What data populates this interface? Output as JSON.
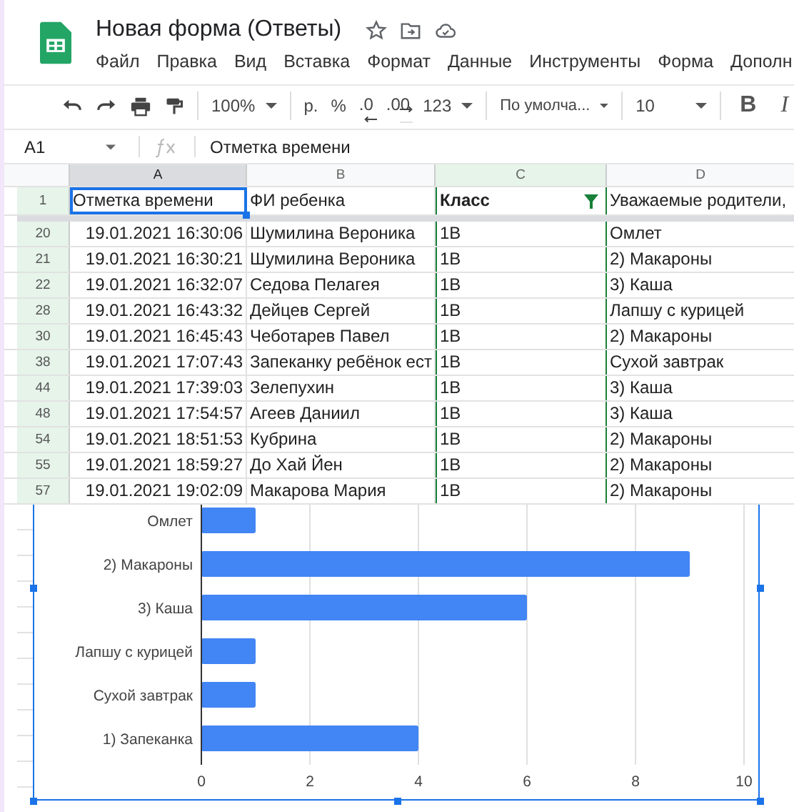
{
  "document": {
    "title": "Новая форма (Ответы)"
  },
  "menu": [
    "Файл",
    "Правка",
    "Вид",
    "Вставка",
    "Формат",
    "Данные",
    "Инструменты",
    "Форма",
    "Дополн"
  ],
  "toolbar": {
    "zoom": "100%",
    "currency": "р.",
    "percent": "%",
    "decimal_decrease": ".0",
    "decimal_increase": ".00",
    "number_format": "123",
    "font": "По умолча...",
    "font_size": "10",
    "bold": "B",
    "italic": "I"
  },
  "formula_bar": {
    "cell": "A1",
    "content": "Отметка времени"
  },
  "columns": [
    {
      "label": "A",
      "selected": true,
      "filtered": false
    },
    {
      "label": "B",
      "selected": false,
      "filtered": false
    },
    {
      "label": "C",
      "selected": false,
      "filtered": true
    },
    {
      "label": "D",
      "selected": false,
      "filtered": false
    }
  ],
  "header_row": {
    "number": "1",
    "cells": [
      {
        "text": "Отметка времени",
        "active": true
      },
      {
        "text": "ФИ ребенка",
        "active": false
      },
      {
        "text": "Класс",
        "active": false
      },
      {
        "text": "Уважаемые родители,",
        "active": false
      }
    ]
  },
  "rows": [
    {
      "number": "20",
      "cells": [
        "19.01.2021 16:30:06",
        "Шумилина Вероника",
        "1В",
        "Омлет"
      ]
    },
    {
      "number": "21",
      "cells": [
        "19.01.2021 16:30:21",
        "Шумилина Вероника",
        "1В",
        "2) Макароны"
      ]
    },
    {
      "number": "22",
      "cells": [
        "19.01.2021 16:32:07",
        "Седова Пелагея",
        "1В",
        "3) Каша"
      ]
    },
    {
      "number": "28",
      "cells": [
        "19.01.2021 16:43:32",
        "Дейцев Сергей",
        "1В",
        "Лапшу с курицей"
      ]
    },
    {
      "number": "30",
      "cells": [
        "19.01.2021 16:45:43",
        "Чеботарев Павел",
        "1В",
        "2) Макароны"
      ]
    },
    {
      "number": "38",
      "cells": [
        "19.01.2021 17:07:43",
        "Запеканку ребёнок ест",
        "1В",
        "Сухой завтрак"
      ]
    },
    {
      "number": "44",
      "cells": [
        "19.01.2021 17:39:03",
        "Зелепухин",
        "1В",
        "3) Каша"
      ]
    },
    {
      "number": "48",
      "cells": [
        "19.01.2021 17:54:57",
        "Агеев Даниил",
        "1В",
        "3) Каша"
      ]
    },
    {
      "number": "54",
      "cells": [
        "19.01.2021 18:51:53",
        "Кубрина",
        "1В",
        "2) Макароны"
      ]
    },
    {
      "number": "55",
      "cells": [
        "19.01.2021 18:59:27",
        "До Хай Йен",
        "1В",
        "2) Макароны"
      ]
    },
    {
      "number": "57",
      "cells": [
        "19.01.2021 19:02:09",
        "Макарова Мария",
        "1В",
        "2) Макароны"
      ]
    }
  ],
  "chart": {
    "chart_data": {
      "type": "bar",
      "orientation": "horizontal",
      "categories": [
        "Омлет",
        "2) Макароны",
        "3) Каша",
        "Лапшу с курицей",
        "Сухой завтрак",
        "1) Запеканка"
      ],
      "series": [
        {
          "color": "#4285f4",
          "values": [
            1,
            9,
            6,
            1,
            1,
            4
          ]
        }
      ],
      "xlim": [
        0,
        10
      ],
      "xticks": [
        0,
        2,
        4,
        6,
        8,
        10
      ],
      "grid": true
    }
  }
}
